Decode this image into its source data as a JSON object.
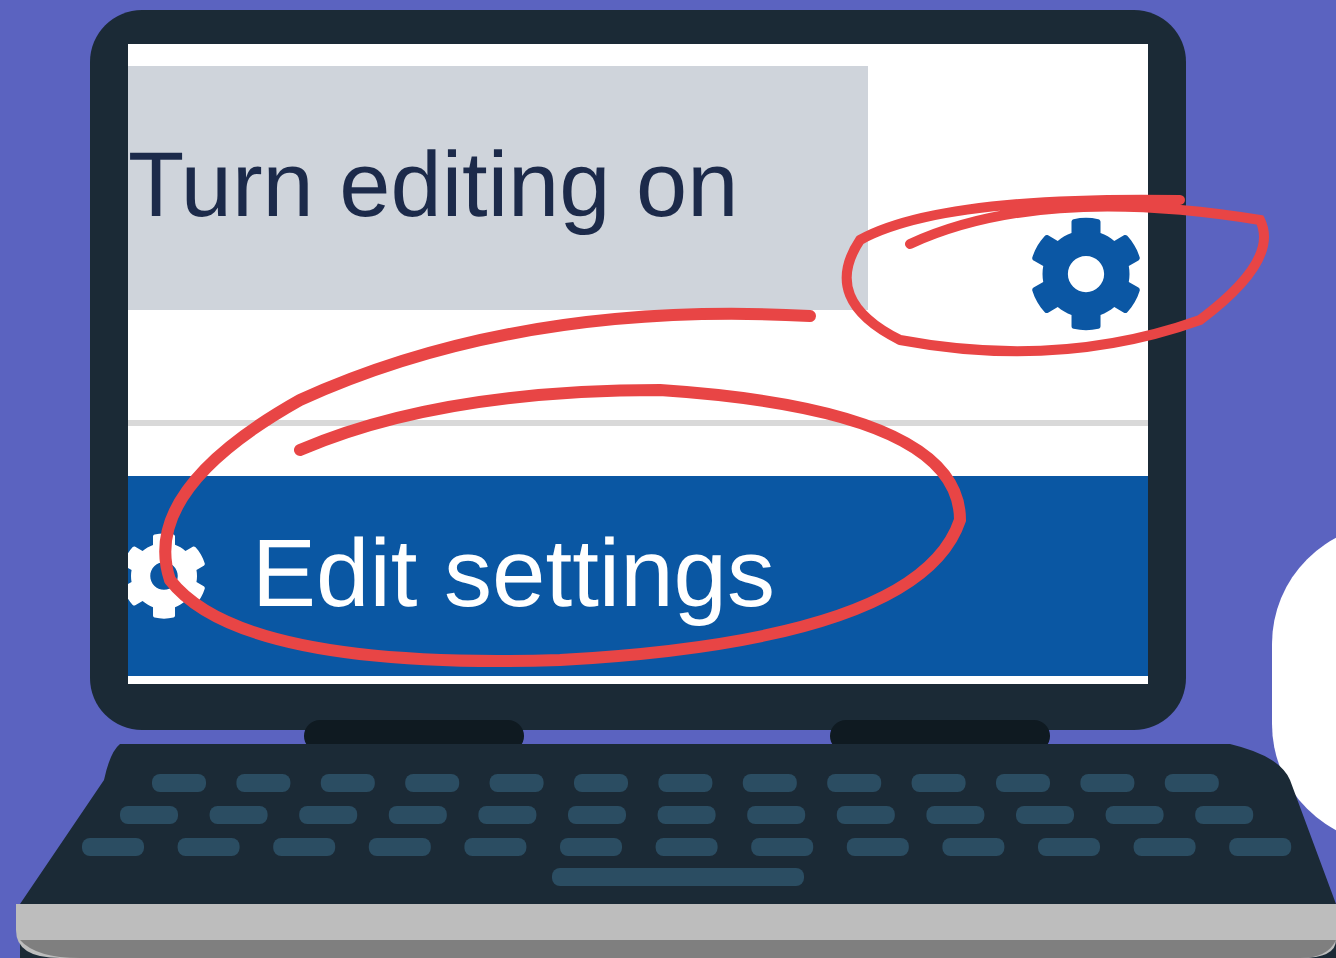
{
  "screen": {
    "button": {
      "label": "Turn editing on"
    },
    "menu_item": {
      "label": "Edit settings",
      "selected": true
    }
  }
}
